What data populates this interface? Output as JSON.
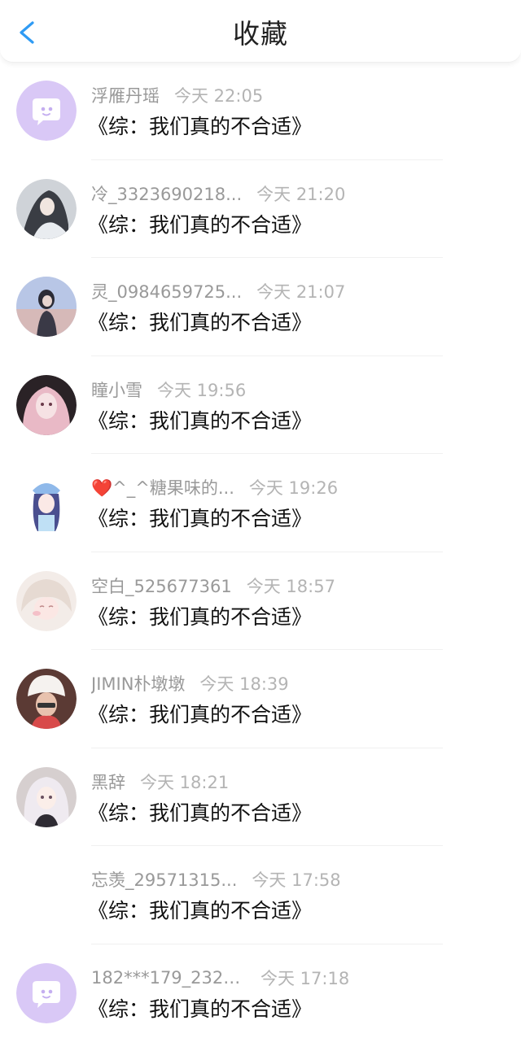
{
  "header": {
    "title": "收藏",
    "back_icon": "chevron-left-icon",
    "accent_color": "#2f9bf4"
  },
  "items": [
    {
      "username": "浮雁丹瑶",
      "time": "今天 22:05",
      "book": "《综：我们真的不合适》",
      "avatar": "default-chat-avatar"
    },
    {
      "username": "冷_3323690218...",
      "time": "今天 21:20",
      "book": "《综：我们真的不合适》",
      "avatar": "photo-avatar"
    },
    {
      "username": "灵_0984659725...",
      "time": "今天 21:07",
      "book": "《综：我们真的不合适》",
      "avatar": "photo-avatar"
    },
    {
      "username": "瞳小雪",
      "time": "今天 19:56",
      "book": "《综：我们真的不合适》",
      "avatar": "photo-avatar"
    },
    {
      "username": "❤️^_^糖果味的...",
      "time": "今天 19:26",
      "book": "《综：我们真的不合适》",
      "avatar": "photo-avatar"
    },
    {
      "username": "空白_525677361",
      "time": "今天 18:57",
      "book": "《综：我们真的不合适》",
      "avatar": "photo-avatar"
    },
    {
      "username": "JIMIN朴墩墩",
      "time": "今天 18:39",
      "book": "《综：我们真的不合适》",
      "avatar": "photo-avatar"
    },
    {
      "username": "黑辞",
      "time": "今天 18:21",
      "book": "《综：我们真的不合适》",
      "avatar": "photo-avatar"
    },
    {
      "username": "忘羡_29571315...",
      "time": "今天 17:58",
      "book": "《综：我们真的不合适》",
      "avatar": "none"
    },
    {
      "username": "182***179_2322...",
      "time": "今天 17:18",
      "book": "《综：我们真的不合适》",
      "avatar": "default-chat-avatar"
    }
  ]
}
